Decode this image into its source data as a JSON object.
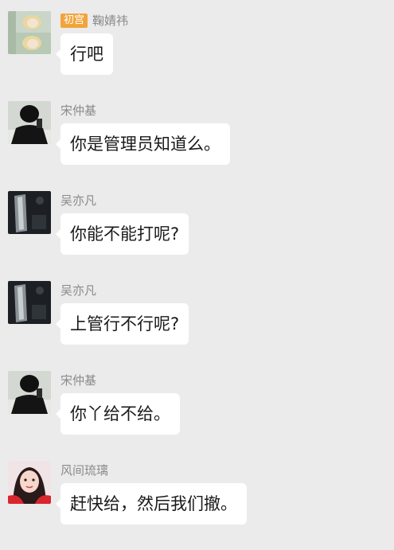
{
  "messages": [
    {
      "badge": "初宫",
      "name": "鞠婧祎",
      "text": "行吧",
      "avatar_icon": "avatar-blonde-portrait-icon"
    },
    {
      "badge": "",
      "name": "宋仲基",
      "text": "你是管理员知道么。",
      "avatar_icon": "avatar-dark-figure-icon"
    },
    {
      "badge": "",
      "name": "吴亦凡",
      "text": "你能不能打呢?",
      "avatar_icon": "avatar-dark-photo-icon"
    },
    {
      "badge": "",
      "name": "吴亦凡",
      "text": "上管行不行呢?",
      "avatar_icon": "avatar-dark-photo-icon"
    },
    {
      "badge": "",
      "name": "宋仲基",
      "text": "你丫给不给。",
      "avatar_icon": "avatar-dark-figure-icon"
    },
    {
      "badge": "",
      "name": "风间琉璃",
      "text": "赶快给，然后我们撤。",
      "avatar_icon": "avatar-girl-red-icon"
    }
  ],
  "colors": {
    "background": "#ebebeb",
    "bubble": "#ffffff",
    "badge": "#f2a43b",
    "name_text": "#8a8a8a",
    "message_text": "#1a1a1a"
  }
}
